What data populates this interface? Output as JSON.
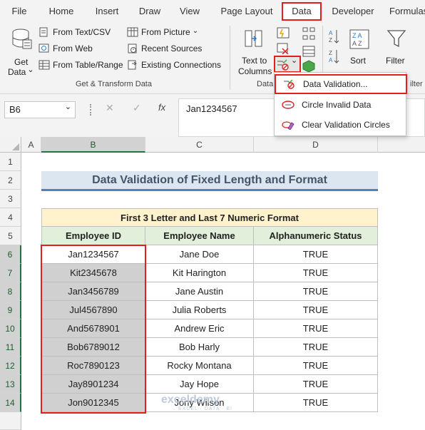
{
  "tabs": [
    "File",
    "Home",
    "Insert",
    "Draw",
    "View",
    "Page Layout",
    "Data",
    "Developer",
    "Formulas"
  ],
  "active_tab": "Data",
  "ribbon": {
    "get_data_line1": "Get",
    "get_data_line2": "Data",
    "get_data_arrow": "⌄",
    "from_text_csv": "From Text/CSV",
    "from_web": "From Web",
    "from_table_range": "From Table/Range",
    "from_picture": "From Picture",
    "from_picture_arrow": "⌄",
    "recent_sources": "Recent Sources",
    "existing_connections": "Existing Connections",
    "get_transform_label": "Get & Transform Data",
    "text_to_columns_line1": "Text to",
    "text_to_columns_line2": "Columns",
    "data_tools_label": "Data",
    "sort_label": "Sort",
    "filter_label": "Filter",
    "filter_group_label": "ilter",
    "validation_arrow": "⌄"
  },
  "dropdown": {
    "items": [
      "Data Validation...",
      "Circle Invalid Data",
      "Clear Validation Circles"
    ]
  },
  "formula_bar": {
    "name_box": "B6",
    "name_arrow": "⌄",
    "cancel_icon": "✕",
    "enter_icon": "✓",
    "fx": "fx",
    "content": "Jan1234567"
  },
  "columns": [
    "A",
    "B",
    "C",
    "D"
  ],
  "rows": [
    "1",
    "2",
    "3",
    "4",
    "5",
    "6",
    "7",
    "8",
    "9",
    "10",
    "11",
    "12",
    "13",
    "14"
  ],
  "sheet": {
    "title": "Data Validation of Fixed Length and Format",
    "table_header": "First 3 Letter and Last 7 Numeric Format",
    "col_headers": [
      "Employee ID",
      "Employee Name",
      "Alphanumeric Status"
    ],
    "rows": [
      [
        "Jan1234567",
        "Jane Doe",
        "TRUE"
      ],
      [
        "Kit2345678",
        "Kit Harington",
        "TRUE"
      ],
      [
        "Jan3456789",
        "Jane Austin",
        "TRUE"
      ],
      [
        "Jul4567890",
        "Julia Roberts",
        "TRUE"
      ],
      [
        "And5678901",
        "Andrew Eric",
        "TRUE"
      ],
      [
        "Bob6789012",
        "Bob Harly",
        "TRUE"
      ],
      [
        "Roc7890123",
        "Rocky Montana",
        "TRUE"
      ],
      [
        "Jay8901234",
        "Jay Hope",
        "TRUE"
      ],
      [
        "Jon9012345",
        "Jony Wilson",
        "TRUE"
      ]
    ]
  },
  "watermark": {
    "name": "exceldemy",
    "tagline": "EXCEL · DATA · BI"
  },
  "colors": {
    "accent_red": "#e0201c",
    "title_fill": "#dce6f1",
    "title_text": "#44546a",
    "header_fill": "#e2efda",
    "subheader_fill": "#fff2cc",
    "selected_fill": "#d0d0d0"
  }
}
